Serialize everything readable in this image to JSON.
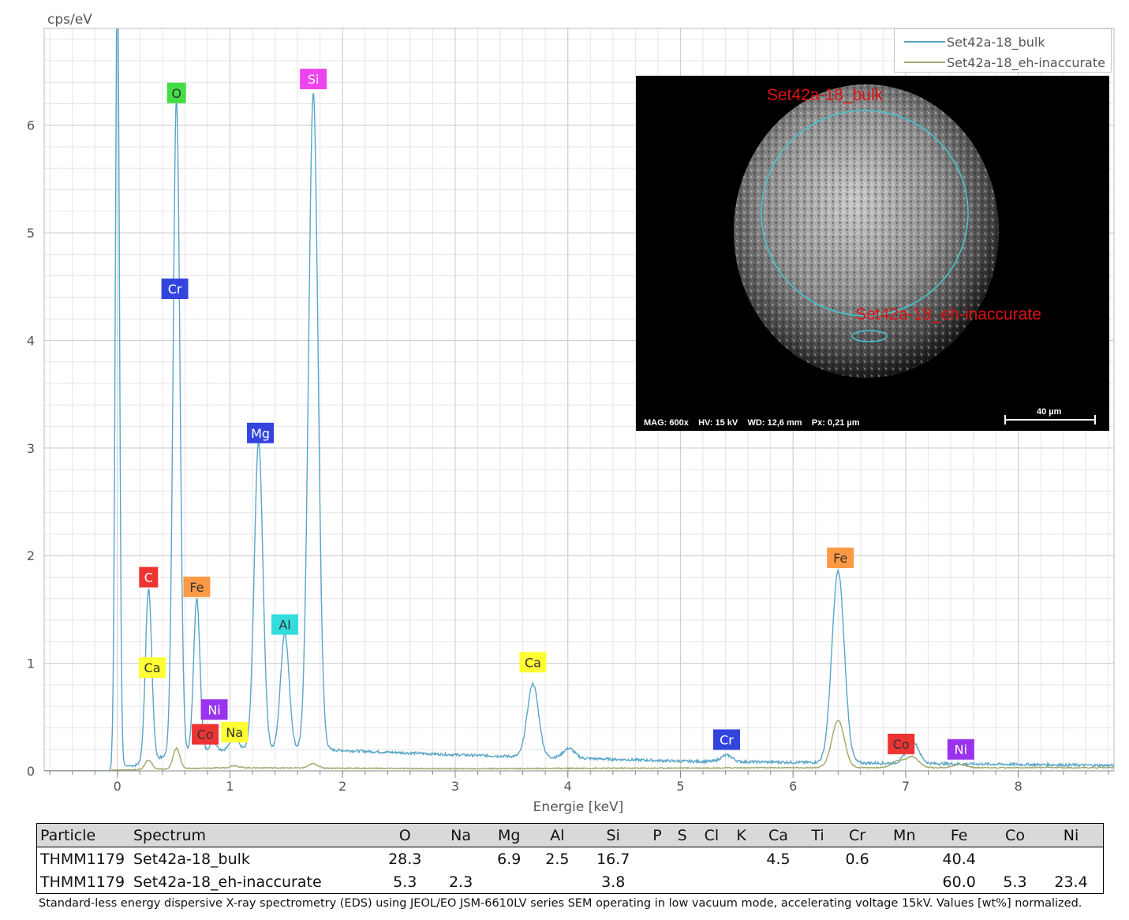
{
  "chart_data": {
    "type": "line",
    "ylabel": "cps/eV",
    "xlabel": "Energie [keV]",
    "xlim": [
      -0.65,
      8.85
    ],
    "ylim": [
      0,
      6.9
    ],
    "x_ticks": [
      0,
      1,
      2,
      3,
      4,
      5,
      6,
      7,
      8
    ],
    "y_ticks": [
      0,
      1,
      2,
      3,
      4,
      5,
      6
    ],
    "grid": true,
    "legend_position": "top-right",
    "series": [
      {
        "name": "Set42a-18_bulk",
        "color": "#5aa5c8",
        "peaks": [
          {
            "x": 0.0,
            "y": 7.5,
            "w": 0.018
          },
          {
            "x": 0.277,
            "y": 1.6,
            "w": 0.028
          },
          {
            "x": 0.525,
            "y": 6.1,
            "w": 0.03
          },
          {
            "x": 0.705,
            "y": 1.42,
            "w": 0.028
          },
          {
            "x": 0.851,
            "y": 0.08,
            "w": 0.03
          },
          {
            "x": 1.04,
            "y": 0.12,
            "w": 0.035
          },
          {
            "x": 1.254,
            "y": 2.86,
            "w": 0.038
          },
          {
            "x": 1.487,
            "y": 1.08,
            "w": 0.038
          },
          {
            "x": 1.74,
            "y": 6.1,
            "w": 0.042
          },
          {
            "x": 3.69,
            "y": 0.68,
            "w": 0.05
          },
          {
            "x": 4.01,
            "y": 0.09,
            "w": 0.05
          },
          {
            "x": 5.41,
            "y": 0.06,
            "w": 0.05
          },
          {
            "x": 6.4,
            "y": 1.78,
            "w": 0.055
          },
          {
            "x": 7.06,
            "y": 0.21,
            "w": 0.055
          }
        ],
        "baseline": [
          [
            -0.65,
            0.0
          ],
          [
            0.15,
            0.05
          ],
          [
            0.5,
            0.16
          ],
          [
            1.0,
            0.2
          ],
          [
            1.8,
            0.2
          ],
          [
            2.0,
            0.19
          ],
          [
            3.0,
            0.15
          ],
          [
            4.0,
            0.12
          ],
          [
            5.0,
            0.09
          ],
          [
            6.0,
            0.08
          ],
          [
            7.0,
            0.07
          ],
          [
            8.0,
            0.06
          ],
          [
            8.85,
            0.05
          ]
        ]
      },
      {
        "name": "Set42a-18_eh-inaccurate",
        "color": "#a0a86a",
        "peaks": [
          {
            "x": 0.277,
            "y": 0.09,
            "w": 0.03
          },
          {
            "x": 0.525,
            "y": 0.19,
            "w": 0.03
          },
          {
            "x": 1.04,
            "y": 0.02,
            "w": 0.035
          },
          {
            "x": 1.74,
            "y": 0.04,
            "w": 0.04
          },
          {
            "x": 6.4,
            "y": 0.44,
            "w": 0.055
          },
          {
            "x": 6.93,
            "y": 0.06,
            "w": 0.055
          },
          {
            "x": 7.06,
            "y": 0.1,
            "w": 0.055
          },
          {
            "x": 7.48,
            "y": 0.03,
            "w": 0.055
          }
        ],
        "baseline": [
          [
            -0.65,
            0.0
          ],
          [
            0.15,
            0.01
          ],
          [
            1.0,
            0.03
          ],
          [
            3.0,
            0.02
          ],
          [
            6.0,
            0.03
          ],
          [
            8.85,
            0.03
          ]
        ]
      }
    ],
    "annotations": [
      {
        "text": "O",
        "x": 0.525,
        "y": 6.3,
        "color": "#44dd44",
        "text_color": "#333"
      },
      {
        "text": "Si",
        "x": 1.74,
        "y": 6.43,
        "color": "#ee44ee",
        "text_color": "#ffffff"
      },
      {
        "text": "Cr",
        "x": 0.51,
        "y": 4.48,
        "color": "#3344dd",
        "text_color": "#ffffff"
      },
      {
        "text": "Mg",
        "x": 1.27,
        "y": 3.14,
        "color": "#3344dd",
        "text_color": "#ffffff"
      },
      {
        "text": "C",
        "x": 0.277,
        "y": 1.8,
        "color": "#ee3333",
        "text_color": "#ffffff"
      },
      {
        "text": "Fe",
        "x": 0.705,
        "y": 1.71,
        "color": "#ff9944",
        "text_color": "#333"
      },
      {
        "text": "Al",
        "x": 1.487,
        "y": 1.36,
        "color": "#33dddd",
        "text_color": "#333"
      },
      {
        "text": "Ca",
        "x": 0.31,
        "y": 0.96,
        "color": "#ffff33",
        "text_color": "#333"
      },
      {
        "text": "Ni",
        "x": 0.86,
        "y": 0.57,
        "color": "#9933ee",
        "text_color": "#ffffff"
      },
      {
        "text": "Co",
        "x": 0.78,
        "y": 0.34,
        "color": "#ee3333",
        "text_color": "#333"
      },
      {
        "text": "Na",
        "x": 1.04,
        "y": 0.36,
        "color": "#ffff33",
        "text_color": "#333"
      },
      {
        "text": "Ca",
        "x": 3.69,
        "y": 1.01,
        "color": "#ffff33",
        "text_color": "#333"
      },
      {
        "text": "Cr",
        "x": 5.41,
        "y": 0.29,
        "color": "#3344dd",
        "text_color": "#ffffff"
      },
      {
        "text": "Fe",
        "x": 6.42,
        "y": 1.98,
        "color": "#ff9944",
        "text_color": "#333"
      },
      {
        "text": "Co",
        "x": 6.96,
        "y": 0.25,
        "color": "#ee3333",
        "text_color": "#333"
      },
      {
        "text": "Ni",
        "x": 7.49,
        "y": 0.2,
        "color": "#9933ee",
        "text_color": "#ffffff"
      }
    ]
  },
  "sem_image": {
    "region_1_label": "Set42a-18_bulk",
    "region_2_label": "Set42a-18_eh-inaccurate",
    "info": "MAG: 600x    HV: 15 kV    WD: 12,6 mm    Px: 0,21 µm",
    "scale_bar": "40 µm"
  },
  "table": {
    "headers": [
      "Particle",
      "Spectrum",
      "O",
      "Na",
      "Mg",
      "Al",
      "Si",
      "P",
      "S",
      "Cl",
      "K",
      "Ca",
      "Ti",
      "Cr",
      "Mn",
      "Fe",
      "Co",
      "Ni"
    ],
    "rows": [
      [
        "THMM1179",
        "Set42a-18_bulk",
        "28.3",
        "",
        "6.9",
        "2.5",
        "16.7",
        "",
        "",
        "",
        "",
        "4.5",
        "",
        "0.6",
        "",
        "40.4",
        "",
        ""
      ],
      [
        "THMM1179",
        "Set42a-18_eh-inaccurate",
        "5.3",
        "2.3",
        "",
        "",
        "3.8",
        "",
        "",
        "",
        "",
        "",
        "",
        "",
        "",
        "60.0",
        "5.3",
        "23.4"
      ]
    ]
  },
  "footnote": "Standard-less energy dispersive X-ray spectrometry (EDS) using JEOL/EO JSM-6610LV series SEM operating in low vacuum mode, accelerating voltage 15kV. Values [wt%] normalized."
}
